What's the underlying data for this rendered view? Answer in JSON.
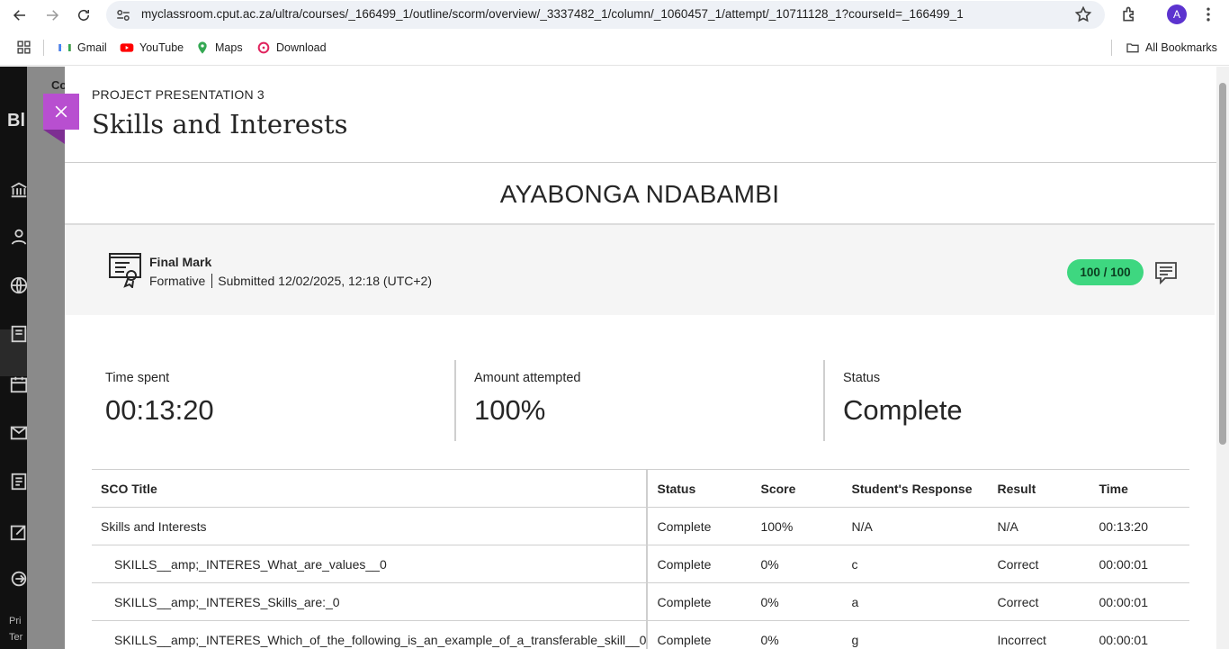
{
  "browser": {
    "url": "myclassroom.cput.ac.za/ultra/courses/_166499_1/outline/scorm/overview/_3337482_1/column/_1060457_1/attempt/_10711128_1?courseId=_166499_1",
    "profile_initial": "A",
    "bookmarks": [
      {
        "label": "Gmail",
        "icon": "gmail-icon"
      },
      {
        "label": "YouTube",
        "icon": "youtube-icon"
      },
      {
        "label": "Maps",
        "icon": "maps-icon"
      },
      {
        "label": "Download",
        "icon": "download-icon"
      }
    ],
    "all_bookmarks_label": "All Bookmarks"
  },
  "background_app": {
    "strip_text": "Co",
    "rail_text_1": "Pri",
    "rail_text_2": "Ter"
  },
  "panel": {
    "eyebrow": "PROJECT PRESENTATION 3",
    "title": "Skills and Interests",
    "student_name": "AYABONGA NDABAMBI",
    "final_mark": {
      "label": "Final Mark",
      "type": "Formative",
      "submitted": "Submitted 12/02/2025, 12:18 (UTC+2)",
      "grade": "100 / 100",
      "grade_color": "#3ed780"
    },
    "stats": [
      {
        "label": "Time spent",
        "value": "00:13:20"
      },
      {
        "label": "Amount attempted",
        "value": "100%"
      },
      {
        "label": "Status",
        "value": "Complete"
      }
    ],
    "table": {
      "headers": [
        "SCO Title",
        "Status",
        "Score",
        "Student's Response",
        "Result",
        "Time"
      ],
      "rows": [
        {
          "title": "Skills and Interests",
          "status": "Complete",
          "score": "100%",
          "response": "N/A",
          "result": "N/A",
          "time": "00:13:20"
        },
        {
          "title": "SKILLS__amp;_INTERES_What_are_values__0",
          "status": "Complete",
          "score": "0%",
          "response": "c",
          "result": "Correct",
          "time": "00:00:01"
        },
        {
          "title": "SKILLS__amp;_INTERES_Skills_are:_0",
          "status": "Complete",
          "score": "0%",
          "response": "a",
          "result": "Correct",
          "time": "00:00:01"
        },
        {
          "title": "SKILLS__amp;_INTERES_Which_of_the_following_is_an_example_of_a_transferable_skill__0",
          "status": "Complete",
          "score": "0%",
          "response": "g",
          "result": "Incorrect",
          "time": "00:00:01"
        }
      ]
    }
  },
  "accent_color": "#b84fd0"
}
